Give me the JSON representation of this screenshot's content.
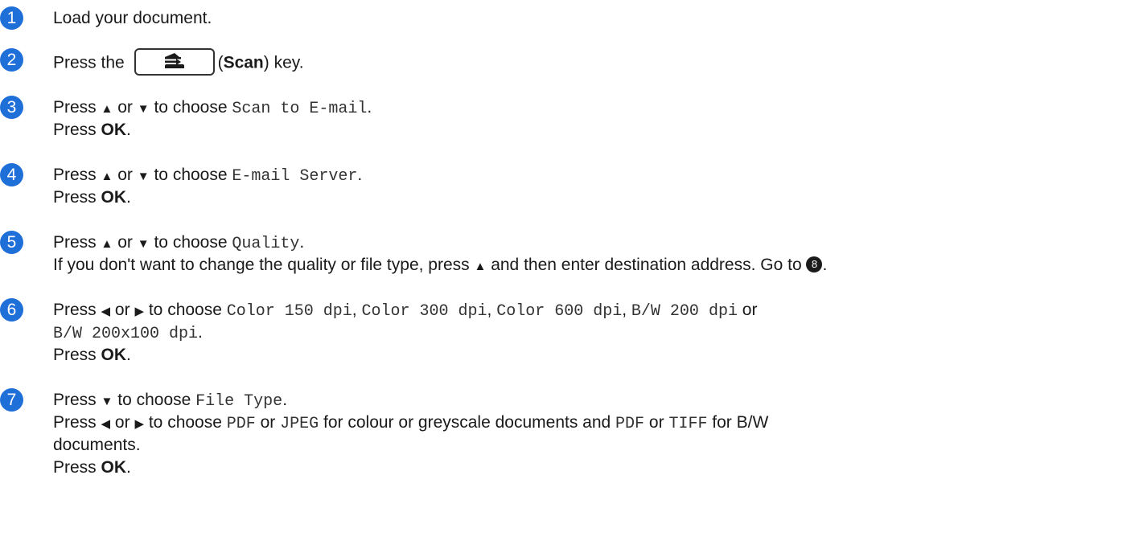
{
  "step_numbers": [
    "1",
    "2",
    "3",
    "4",
    "5",
    "6",
    "7"
  ],
  "s1": {
    "text": "Load your document."
  },
  "s2": {
    "a": "Press the",
    "b": "(",
    "c": "Scan",
    "d": ") key.",
    "key_icon": "scan-arrow-icon"
  },
  "s3": {
    "a": "Press",
    "b": "or",
    "c": "to choose",
    "m": "Scan to E-mail",
    "e": ".",
    "p": "Press ",
    "ok": "OK",
    "p2": "."
  },
  "s4": {
    "a": "Press",
    "b": "or",
    "c": "to choose",
    "m": "E-mail Server",
    "e": ".",
    "p": "Press ",
    "ok": "OK",
    "p2": "."
  },
  "s5": {
    "a": "Press",
    "b": "or",
    "c": "to choose",
    "m": "Quality",
    "e": ".",
    "l2a": "If you don't want to change the quality or file type, press",
    "l2b": "and then enter destination address. Go to",
    "ref": "8",
    "l2c": "."
  },
  "s6": {
    "a": "Press",
    "b": "or",
    "c": "to choose",
    "m1": "Color 150 dpi",
    "sep1": ",",
    "m2": "Color 300 dpi",
    "sep2": ",",
    "m3": "Color 600 dpi",
    "sep3": ",",
    "m4": "B/W 200 dpi",
    "or": "or",
    "m5": "B/W 200x100 dpi",
    "e": ".",
    "p": "Press ",
    "ok": "OK",
    "p2": "."
  },
  "s7": {
    "a": "Press",
    "c": "to choose",
    "m": "File Type",
    "e": ".",
    "l2a": "Press",
    "l2b": "or",
    "l2c": "to choose",
    "m1": "PDF",
    "or1": "or",
    "m2": "JPEG",
    "l2d": "for colour or greyscale documents and",
    "m3": "PDF",
    "or2": "or",
    "m4": "TIFF",
    "l2e": "for B/W",
    "l3": "documents.",
    "p": "Press ",
    "ok": "OK",
    "p2": "."
  },
  "arrows": {
    "up": "▲",
    "down": "▼",
    "left": "◀",
    "right": "▶"
  },
  "colors": {
    "step_badge": "#1f6fd9",
    "text": "#1a1a1a"
  }
}
